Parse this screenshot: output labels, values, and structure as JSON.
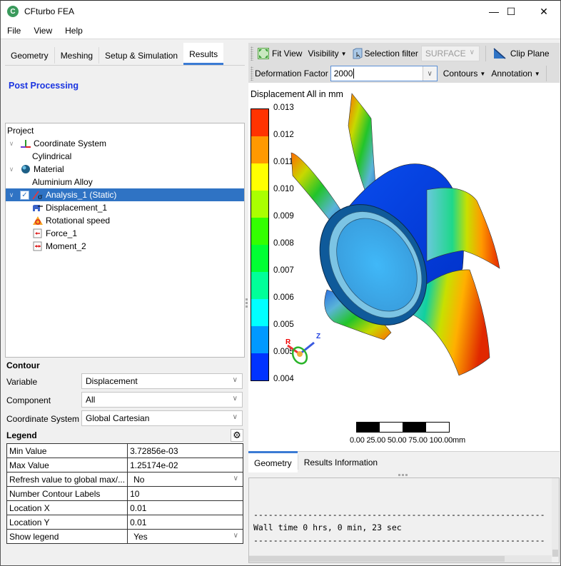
{
  "window": {
    "title": "CFturbo  FEA",
    "app_icon_letter": "C",
    "controls": {
      "minimize": "—",
      "maximize": "☐",
      "close": "✕"
    }
  },
  "menu": [
    "File",
    "View",
    "Help"
  ],
  "left": {
    "tabs": [
      {
        "label": "Geometry",
        "active": false
      },
      {
        "label": "Meshing",
        "active": false
      },
      {
        "label": "Setup & Simulation",
        "active": false
      },
      {
        "label": "Results",
        "active": true
      }
    ],
    "section_title": "Post Processing",
    "tree": {
      "root": "Project",
      "items": [
        {
          "label": "Coordinate System",
          "icon": "axes-icon",
          "expanded": true,
          "level": 0
        },
        {
          "label": "Cylindrical",
          "level": 1
        },
        {
          "label": "Material",
          "icon": "sphere-icon",
          "expanded": true,
          "level": 0
        },
        {
          "label": "Aluminium Alloy",
          "level": 1
        },
        {
          "label": "Analysis_1 (Static)",
          "icon": "stress-icon",
          "expanded": true,
          "checked": true,
          "selected": true,
          "level": 0
        },
        {
          "label": "Displacement_1",
          "icon": "displacement-icon",
          "level": 1
        },
        {
          "label": "Rotational speed",
          "icon": "rotation-icon",
          "level": 1
        },
        {
          "label": "Force_1",
          "icon": "force-icon",
          "level": 1
        },
        {
          "label": "Moment_2",
          "icon": "moment-icon",
          "level": 1
        }
      ]
    },
    "contour": {
      "title": "Contour",
      "fields": [
        {
          "label": "Variable",
          "value": "Displacement"
        },
        {
          "label": "Component",
          "value": "All"
        },
        {
          "label": "Coordinate System",
          "value": "Global Cartesian"
        }
      ]
    },
    "legend": {
      "title": "Legend",
      "rows": [
        {
          "key": "Min Value",
          "value": "3.72856e-03",
          "dropdown": false
        },
        {
          "key": "Max Value",
          "value": "1.25174e-02",
          "dropdown": false
        },
        {
          "key": "Refresh value to global max/...",
          "value": "No",
          "dropdown": true
        },
        {
          "key": "Number Contour Labels",
          "value": "10",
          "dropdown": false
        },
        {
          "key": "Location X",
          "value": "0.01",
          "dropdown": false
        },
        {
          "key": "Location Y",
          "value": "0.01",
          "dropdown": false
        },
        {
          "key": "Show legend",
          "value": "Yes",
          "dropdown": true
        }
      ]
    }
  },
  "toolbar": {
    "fit_view": "Fit View",
    "visibility": "Visibility",
    "selection_filter": "Selection filter",
    "selection_filter_value": "SURFACE",
    "clip_plane": "Clip Plane",
    "deformation_factor_label": "Deformation Factor",
    "deformation_factor_value": "2000",
    "contours": "Contours",
    "annotation": "Annotation"
  },
  "viewport": {
    "title": "Displacement All in mm",
    "legend_labels": [
      "0.013",
      "0.012",
      "0.011",
      "0.010",
      "0.009",
      "0.008",
      "0.007",
      "0.006",
      "0.005",
      "0.005",
      "0.004"
    ],
    "legend_colors": [
      "#ff3300",
      "#ff9900",
      "#ffff00",
      "#aaff00",
      "#33ff00",
      "#00ff33",
      "#00ff99",
      "#00ffff",
      "#0099ff",
      "#0033ff"
    ],
    "triad": {
      "r": "R",
      "z": "Z"
    },
    "scale_labels": "0.00  25.00  50.00  75.00 100.00mm"
  },
  "bottom": {
    "tabs": [
      {
        "label": "Geometry",
        "active": true
      },
      {
        "label": "Results Information",
        "active": false
      }
    ],
    "console_lines": [
      "-----------------------------------------------------------",
      "Wall time 0 hrs, 0 min, 23 sec",
      "-----------------------------------------------------------"
    ]
  }
}
